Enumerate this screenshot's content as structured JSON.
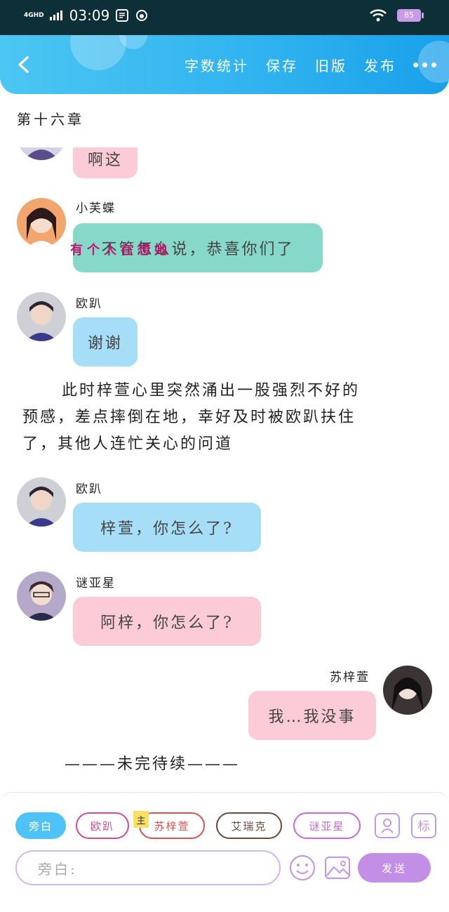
{
  "status_bar": {
    "network": "4GHD",
    "time": "03:09",
    "battery": "85"
  },
  "header": {
    "actions": [
      "字数统计",
      "保存",
      "旧版",
      "发布"
    ]
  },
  "chapter_title": "第十六章",
  "messages": [
    {
      "type": "chat",
      "side": "left",
      "name": "",
      "text": "啊这",
      "color": "pink"
    },
    {
      "type": "chat",
      "side": "left",
      "name": "小芙蝶",
      "text": "不管怎么说，恭喜你们了",
      "color": "teal",
      "overlay": "有个人在想她"
    },
    {
      "type": "chat",
      "side": "left",
      "name": "欧趴",
      "text": "谢谢",
      "color": "blue"
    },
    {
      "type": "narration",
      "lines": [
        "此时梓萱心里突然涌出一股强烈不好的",
        "预感，差点摔倒在地，幸好及时被欧趴扶住",
        "了，其他人连忙关心的问道"
      ]
    },
    {
      "type": "chat",
      "side": "left",
      "name": "欧趴",
      "text": "梓萱，你怎么了?",
      "color": "blue"
    },
    {
      "type": "chat",
      "side": "left",
      "name": "谜亚星",
      "text": "阿梓，你怎么了?",
      "color": "pink"
    },
    {
      "type": "chat",
      "side": "right",
      "name": "苏梓萱",
      "text": "我…我没事",
      "color": "pink"
    },
    {
      "type": "narration",
      "lines": [
        "———未完待续———"
      ]
    }
  ],
  "composer": {
    "chips": [
      {
        "label": "旁白",
        "color": "#4fc3f7",
        "filled": true
      },
      {
        "label": "欧趴",
        "color": "#d94a8a",
        "filled": false
      },
      {
        "label": "苏梓萱",
        "color": "#d9534f",
        "filled": false,
        "badge": "主"
      },
      {
        "label": "艾瑞克",
        "color": "#6b4a3a",
        "filled": false
      },
      {
        "label": "谜亚星",
        "color": "#c86bd4",
        "filled": false
      }
    ],
    "tag_icon_label": "标",
    "input_placeholder": "旁白:",
    "send_label": "发送"
  },
  "colors": {
    "header_start": "#4cc6f3",
    "header_end": "#1aa0ea",
    "accent": "#c38fe6"
  }
}
